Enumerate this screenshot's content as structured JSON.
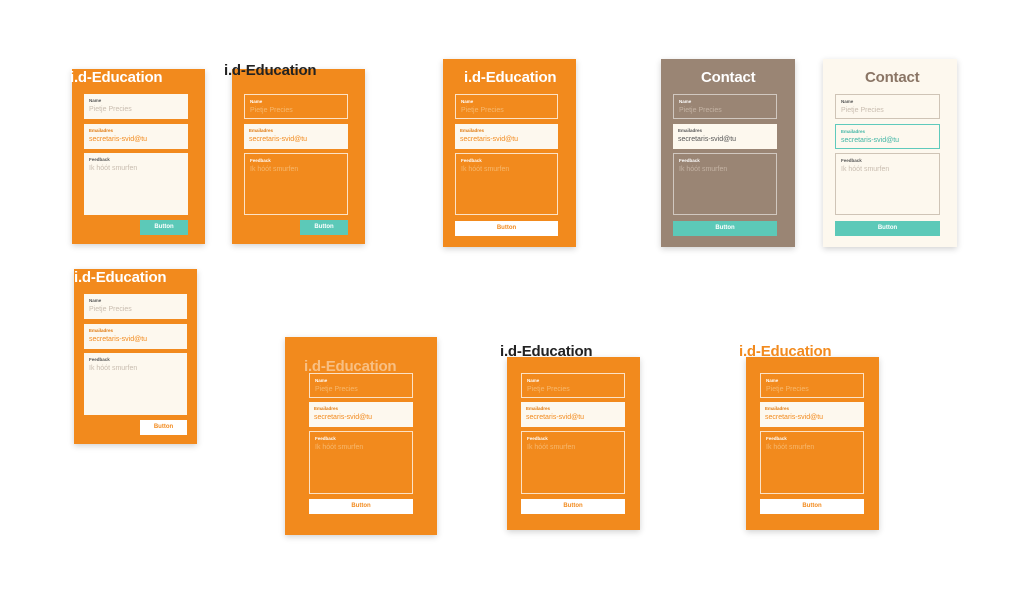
{
  "brand_title": "i.d-Education",
  "contact_title": "Contact",
  "form": {
    "name_label": "Name",
    "name_placeholder": "Pietje Precies",
    "email_label": "Emailadres",
    "email_value": "secretaris-svid@tu",
    "feedback_label": "Feedback",
    "feedback_placeholder": "Ik hóót smurfen",
    "button_label": "Button"
  },
  "colors": {
    "orange": "#f28a1d",
    "taupe": "#9a8574",
    "cream": "#fdf8ee",
    "teal": "#5cc9b8"
  }
}
